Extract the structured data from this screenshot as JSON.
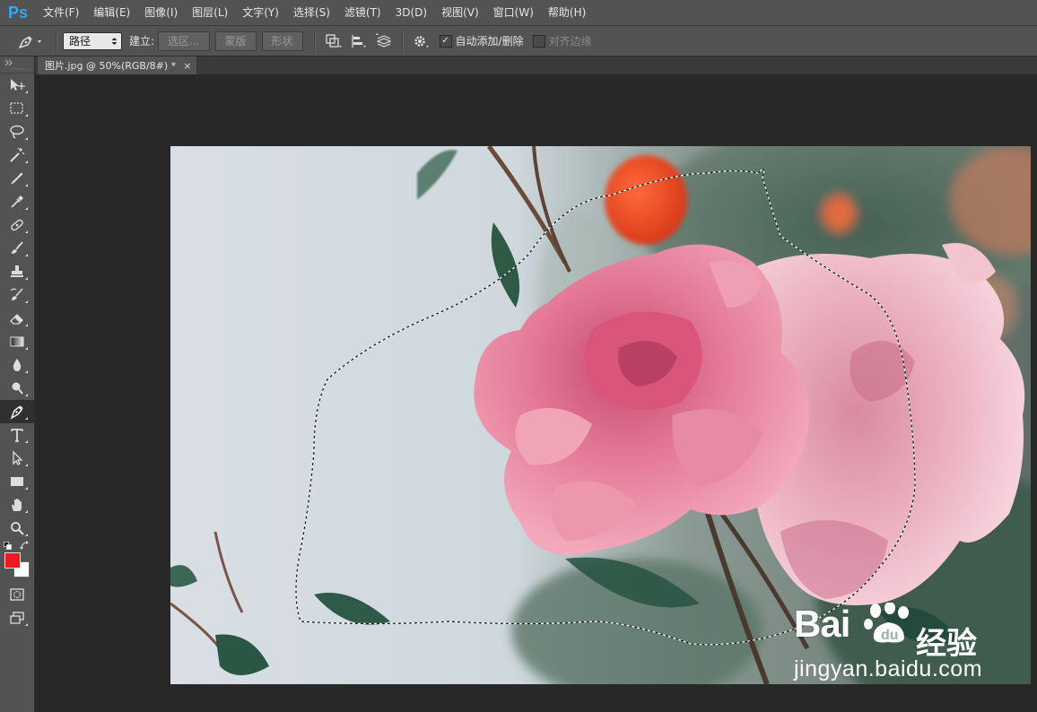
{
  "app": {
    "logo_text": "Ps"
  },
  "menu": {
    "items": [
      {
        "label": "文件(F)"
      },
      {
        "label": "编辑(E)"
      },
      {
        "label": "图像(I)"
      },
      {
        "label": "图层(L)"
      },
      {
        "label": "文字(Y)"
      },
      {
        "label": "选择(S)"
      },
      {
        "label": "滤镜(T)"
      },
      {
        "label": "3D(D)"
      },
      {
        "label": "视图(V)"
      },
      {
        "label": "窗口(W)"
      },
      {
        "label": "帮助(H)"
      }
    ]
  },
  "options": {
    "tool_preset_icon": "pen-icon",
    "mode_value": "路径",
    "build_label": "建立:",
    "selection_button": "选区...",
    "mask_button": "蒙版",
    "shape_button": "形状",
    "path_operations_icon": "path-operations-icon",
    "path_alignment_icon": "path-alignment-icon",
    "path_arrangement_icon": "path-arrangement-icon",
    "settings_icon": "gear-icon",
    "auto_add_delete": {
      "label": "自动添加/删除",
      "checked": true
    },
    "align_edges": {
      "label": "对齐边缘",
      "checked": false,
      "disabled": true
    }
  },
  "document": {
    "tab_title": "图片.jpg @ 50%(RGB/8#) *",
    "close_glyph": "×"
  },
  "tools": [
    {
      "name": "move-tool",
      "icon": "move-icon"
    },
    {
      "name": "marquee-tool",
      "icon": "rect-marquee-icon"
    },
    {
      "name": "lasso-tool",
      "icon": "lasso-icon"
    },
    {
      "name": "magic-wand-tool",
      "icon": "magic-wand-icon"
    },
    {
      "name": "crop-tool",
      "icon": "crop-icon"
    },
    {
      "name": "eyedropper-tool",
      "icon": "eyedropper-icon"
    },
    {
      "name": "healing-brush-tool",
      "icon": "bandage-icon"
    },
    {
      "name": "brush-tool",
      "icon": "brush-icon"
    },
    {
      "name": "clone-stamp-tool",
      "icon": "stamp-icon"
    },
    {
      "name": "history-brush-tool",
      "icon": "history-brush-icon"
    },
    {
      "name": "eraser-tool",
      "icon": "eraser-icon"
    },
    {
      "name": "gradient-tool",
      "icon": "gradient-icon"
    },
    {
      "name": "blur-tool",
      "icon": "blur-drop-icon"
    },
    {
      "name": "dodge-tool",
      "icon": "dodge-icon"
    },
    {
      "name": "pen-tool",
      "icon": "pen-icon",
      "active": true
    },
    {
      "name": "type-tool",
      "icon": "type-icon"
    },
    {
      "name": "path-selection-tool",
      "icon": "path-selection-arrow-icon"
    },
    {
      "name": "shape-tool",
      "icon": "rectangle-shape-icon"
    },
    {
      "name": "hand-tool",
      "icon": "hand-icon"
    },
    {
      "name": "zoom-tool",
      "icon": "zoom-icon"
    }
  ],
  "colors": {
    "foreground": "#ed1c24",
    "background": "#ffffff",
    "ui_panel": "#535353",
    "workspace": "#282828"
  },
  "watermark": {
    "brand_left": "Bai",
    "brand_suffix": "经验",
    "url": "jingyan.baidu.com"
  }
}
